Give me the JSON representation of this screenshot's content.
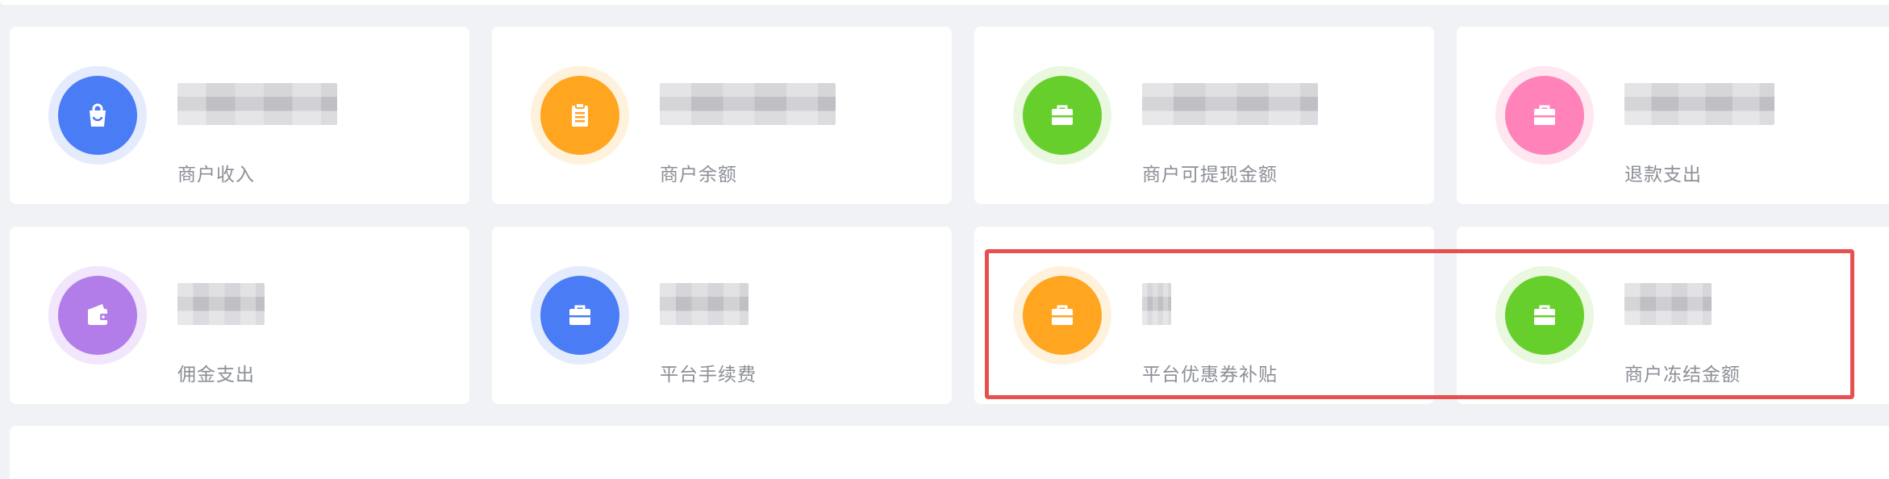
{
  "cards": [
    {
      "label": "商户收入",
      "icon": "shopping-bag-icon",
      "color": "#4a7cf6",
      "ring": "#e4ebfd"
    },
    {
      "label": "商户余额",
      "icon": "clipboard-icon",
      "color": "#ffa51f",
      "ring": "#fff2dd"
    },
    {
      "label": "商户可提现金额",
      "icon": "briefcase-icon",
      "color": "#67cf2b",
      "ring": "#e9f8df"
    },
    {
      "label": "退款支出",
      "icon": "briefcase-icon",
      "color": "#ff82b9",
      "ring": "#ffe7f2"
    },
    {
      "label": "佣金支出",
      "icon": "wallet-icon",
      "color": "#b27de8",
      "ring": "#f1e6fb"
    },
    {
      "label": "平台手续费",
      "icon": "briefcase-icon",
      "color": "#4a7cf6",
      "ring": "#e4ebfd"
    },
    {
      "label": "平台优惠券补贴",
      "icon": "briefcase-icon",
      "color": "#ffa51f",
      "ring": "#fff2dd"
    },
    {
      "label": "商户冻结金额",
      "icon": "briefcase-icon",
      "color": "#67cf2b",
      "ring": "#e9f8df"
    }
  ],
  "highlight_color": "#e8504f"
}
